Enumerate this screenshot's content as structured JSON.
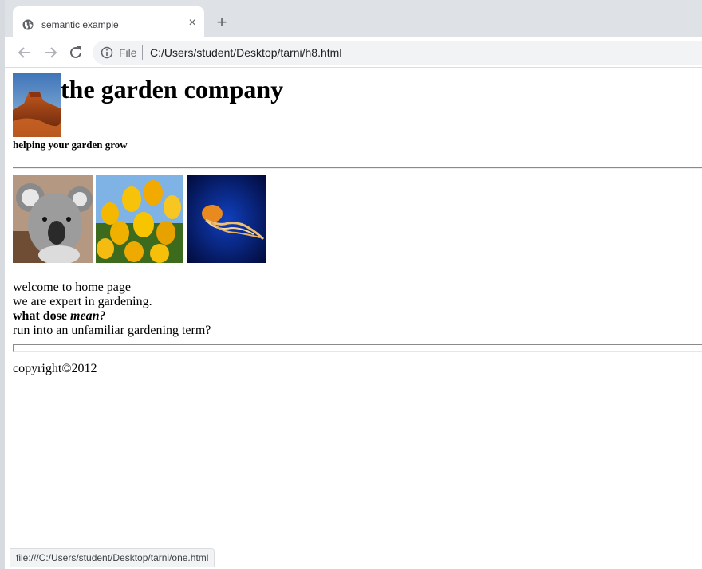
{
  "browser": {
    "tab": {
      "title": "semantic example",
      "close_glyph": "×"
    },
    "new_tab_glyph": "+",
    "address": {
      "scheme_label": "File",
      "url": "C:/Users/student/Desktop/tarni/h8.html"
    },
    "status_url": "file:///C:/Users/student/Desktop/tarni/one.html"
  },
  "page": {
    "title": "the garden company",
    "tagline": "helping your garden grow",
    "lines": {
      "welcome": "welcome to home page",
      "expert": "we are expert in gardening.",
      "question_bold": "what dose ",
      "question_italic": "mean?",
      "unfamiliar": "run into an unfamiliar gardening term?"
    },
    "copyright": "copyright©2012"
  },
  "images": {
    "logo": "canyon-landscape",
    "gallery": [
      "koala",
      "yellow-tulips",
      "jellyfish"
    ]
  },
  "colors": {
    "tab_strip": "#dee1e6",
    "omnibox": "#f1f3f4",
    "text": "#000000"
  }
}
